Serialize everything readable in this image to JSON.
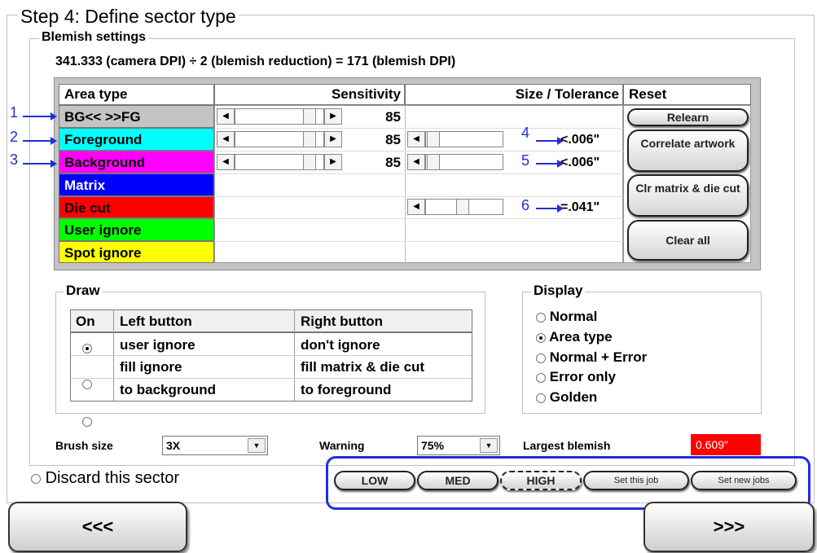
{
  "step_title": "Step 4: Define sector type",
  "blemish": {
    "title": "Blemish settings",
    "formula_prefix": "341.333",
    "formula_middle": " (camera DPI) ÷ 2 (blemish reduction) = ",
    "formula_value": "171",
    "formula_suffix": " (blemish DPI)"
  },
  "table": {
    "headers": {
      "area": "Area type",
      "sensitivity": "Sensitivity",
      "size": "Size / Tolerance",
      "reset": "Reset"
    },
    "rows": [
      {
        "label": "BG<< >>FG",
        "color": "#ffffff",
        "text_color": "#000000",
        "sensitivity": "85",
        "tolerance": ""
      },
      {
        "label": "Foreground",
        "color": "#00ffff",
        "text_color": "#000000",
        "sensitivity": "85",
        "tolerance": "<.006\""
      },
      {
        "label": "Background",
        "color": "#ff00ff",
        "text_color": "#000000",
        "sensitivity": "85",
        "tolerance": "<.006\""
      },
      {
        "label": "Matrix",
        "color": "#0000ff",
        "text_color": "#ffffff",
        "sensitivity": "",
        "tolerance": ""
      },
      {
        "label": "Die cut",
        "color": "#ff0000",
        "text_color": "#000000",
        "sensitivity": "",
        "tolerance": "=.041\""
      },
      {
        "label": "User ignore",
        "color": "#00ff00",
        "text_color": "#000000",
        "sensitivity": "",
        "tolerance": ""
      },
      {
        "label": "Spot ignore",
        "color": "#ffff00",
        "text_color": "#000000",
        "sensitivity": "",
        "tolerance": ""
      }
    ],
    "reset_buttons": {
      "relearn": "Relearn",
      "correlate": "Correlate artwork",
      "clr_matrix": "Clr matrix & die cut",
      "clear_all": "Clear all"
    }
  },
  "callouts": [
    "1",
    "2",
    "3",
    "4",
    "5",
    "6"
  ],
  "draw": {
    "title": "Draw",
    "headers": {
      "on": "On",
      "left": "Left button",
      "right": "Right button"
    },
    "rows": [
      {
        "left": "user ignore",
        "right": "don't ignore",
        "selected": true
      },
      {
        "left": "fill ignore",
        "right": "fill matrix & die cut",
        "selected": false
      },
      {
        "left": "to background",
        "right": "to foreground",
        "selected": false
      }
    ]
  },
  "display": {
    "title": "Display",
    "options": [
      "Normal",
      "Area type",
      "Normal + Error",
      "Error only",
      "Golden"
    ],
    "selected": "Area type"
  },
  "brush_size": {
    "label": "Brush size",
    "value": "3X"
  },
  "warning": {
    "label": "Warning",
    "value": "75%"
  },
  "largest_blemish": {
    "label": "Largest blemish",
    "value": "0.609\"",
    "color": "#ff0000"
  },
  "discard_label": "Discard this sector",
  "presets": {
    "low": "LOW",
    "med": "MED",
    "high": "HIGH",
    "set_this_job": "Set this job",
    "set_new_jobs": "Set new jobs"
  },
  "nav": {
    "back": "<<<",
    "next": ">>>"
  }
}
